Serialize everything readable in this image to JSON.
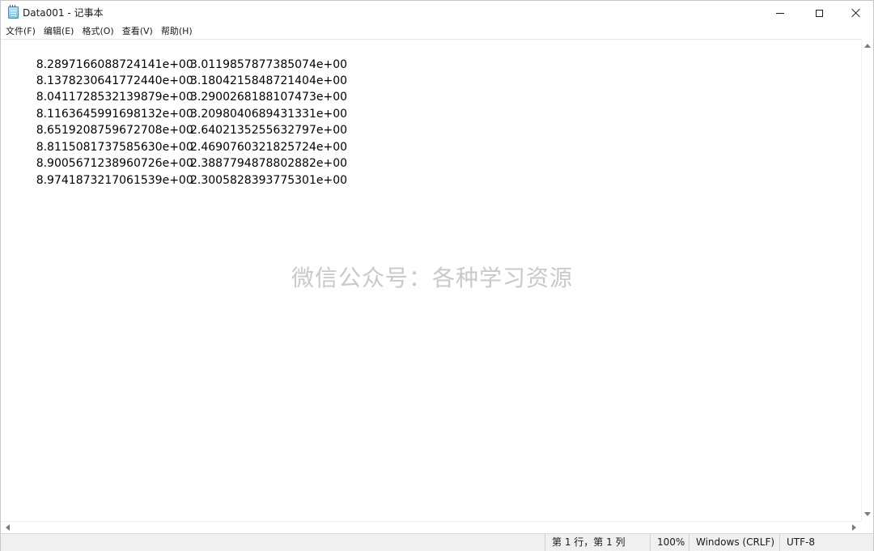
{
  "window": {
    "title": "Data001 - 记事本",
    "icon": "notepad-icon"
  },
  "menu": [
    {
      "label": "文件(F)"
    },
    {
      "label": "编辑(E)"
    },
    {
      "label": "格式(O)"
    },
    {
      "label": "查看(V)"
    },
    {
      "label": "帮助(H)"
    }
  ],
  "editor": {
    "rows": [
      {
        "col1": "8.2897166088724141e+00",
        "col2": "3.0119857877385074e+00"
      },
      {
        "col1": "8.1378230641772440e+00",
        "col2": "3.1804215848721404e+00"
      },
      {
        "col1": "8.0411728532139879e+00",
        "col2": "3.2900268188107473e+00"
      },
      {
        "col1": "8.1163645991698132e+00",
        "col2": "3.2098040689431331e+00"
      },
      {
        "col1": "8.6519208759672708e+00",
        "col2": "2.6402135255632797e+00"
      },
      {
        "col1": "8.8115081737585630e+00",
        "col2": "2.4690760321825724e+00"
      },
      {
        "col1": "8.9005671238960726e+00",
        "col2": "2.3887794878802882e+00"
      },
      {
        "col1": "8.9741873217061539e+00",
        "col2": "2.3005828393775301e+00"
      }
    ],
    "watermark": "微信公众号：各种学习资源"
  },
  "status": {
    "position": "第 1 行，第 1 列",
    "zoom": "100%",
    "line_ending": "Windows (CRLF)",
    "encoding": "UTF-8"
  }
}
